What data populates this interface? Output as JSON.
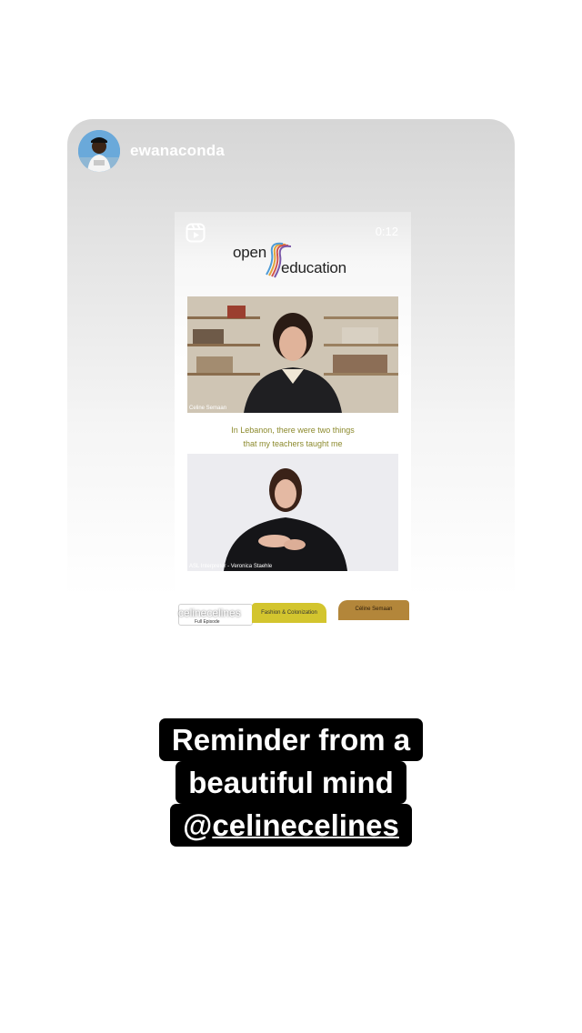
{
  "story": {
    "username": "ewanaconda",
    "avatar_icon": "profile-photo"
  },
  "reel": {
    "icon": "reels-icon",
    "duration": "0:12",
    "logo": {
      "word1": "open",
      "word2": "education"
    },
    "speaker_label": "Celine Semaan",
    "caption_line1": "In Lebanon, there were two things",
    "caption_line2": "that my teachers taught me",
    "interpreter_label": "ASL Interpreter - Veronica Staehle",
    "tag_mid": "Fashion & Colonization",
    "tag_right": "Céline Semaan",
    "tag_left_small": "Full Episode",
    "mention_sticker": "celinecelines"
  },
  "caption": {
    "line1": "Reminder from a",
    "line2": "beautiful mind",
    "line3_prefix": "@",
    "line3_mention": "celinecelines"
  },
  "colors": {
    "caption_bg": "#000000",
    "caption_text": "#ffffff",
    "subtitle_text": "#8c8a2d",
    "tag_yellow": "#d3c52e",
    "tag_brown": "#b3863a"
  }
}
